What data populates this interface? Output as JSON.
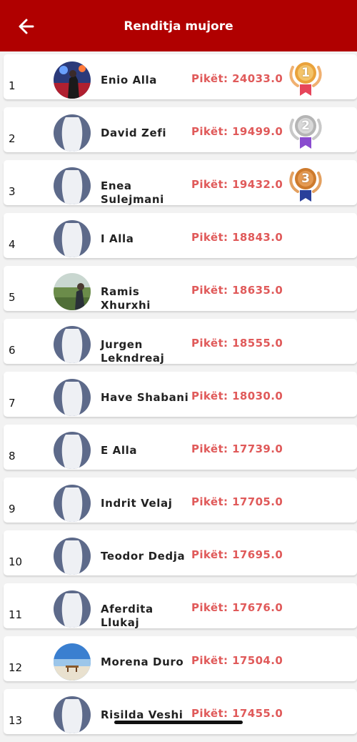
{
  "header": {
    "title": "Renditja mujore",
    "back_icon": "arrow-left-icon"
  },
  "colors": {
    "header_bg": "#b00000",
    "points": "#e05a5a",
    "gold": "#e9a23b",
    "silver": "#b5b5b5",
    "bronze": "#cd7a2c"
  },
  "rows": [
    {
      "rank": "1",
      "name": "Enio Alla",
      "points": "Pikët: 24033.0",
      "avatar": "photo-concert",
      "medal": "1"
    },
    {
      "rank": "2",
      "name": "David Zefi",
      "points": "Pikët: 19499.0",
      "avatar": "placeholder",
      "medal": "2"
    },
    {
      "rank": "3",
      "name": "Enea Sulejmani",
      "points": "Pikët: 19432.0",
      "avatar": "placeholder",
      "medal": "3"
    },
    {
      "rank": "4",
      "name": "I Alla",
      "points": "Pikët: 18843.0",
      "avatar": "placeholder"
    },
    {
      "rank": "5",
      "name": "Ramis Xhurxhi",
      "points": "Pikët: 18635.0",
      "avatar": "photo-field"
    },
    {
      "rank": "6",
      "name": "Jurgen Lekndreaj",
      "points": "Pikët: 18555.0",
      "avatar": "placeholder"
    },
    {
      "rank": "7",
      "name": "Have Shabani",
      "points": "Pikët: 18030.0",
      "avatar": "placeholder"
    },
    {
      "rank": "8",
      "name": "E Alla",
      "points": "Pikët: 17739.0",
      "avatar": "placeholder"
    },
    {
      "rank": "9",
      "name": "Indrit Velaj",
      "points": "Pikët: 17705.0",
      "avatar": "placeholder"
    },
    {
      "rank": "10",
      "name": "Teodor Dedja",
      "points": "Pikët: 17695.0",
      "avatar": "placeholder"
    },
    {
      "rank": "11",
      "name": "Aferdita Llukaj",
      "points": "Pikët: 17676.0",
      "avatar": "placeholder"
    },
    {
      "rank": "12",
      "name": "Morena Duro",
      "points": "Pikët: 17504.0",
      "avatar": "photo-beach"
    },
    {
      "rank": "13",
      "name": "Risilda Veshi",
      "points": "Pikët: 17455.0",
      "avatar": "placeholder"
    }
  ]
}
